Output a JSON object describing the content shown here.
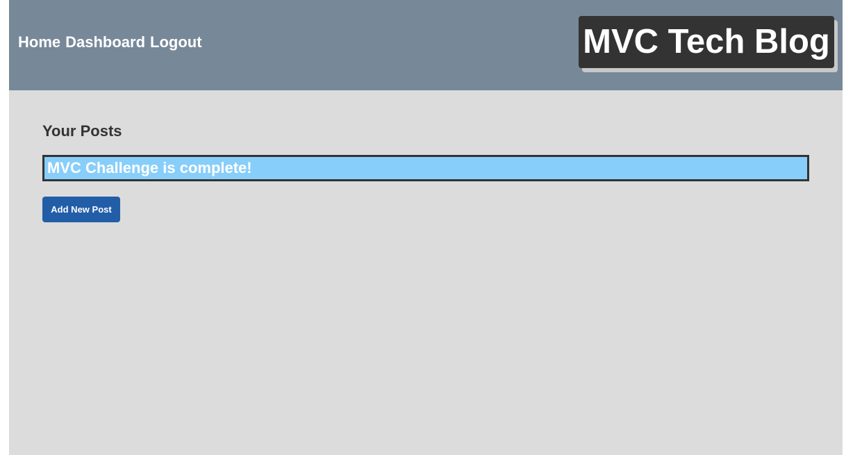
{
  "header": {
    "nav": {
      "home": "Home",
      "dashboard": "Dashboard",
      "logout": "Logout"
    },
    "brand": "MVC Tech Blog"
  },
  "main": {
    "section_title": "Your Posts",
    "posts": [
      {
        "title": "MVC Challenge is complete!"
      }
    ],
    "add_button_label": "Add New Post"
  },
  "colors": {
    "header_bg": "#778899",
    "page_bg": "#dcdcdc",
    "brand_bg": "#333333",
    "post_bg": "#87cefa",
    "button_bg": "#225ea8"
  }
}
